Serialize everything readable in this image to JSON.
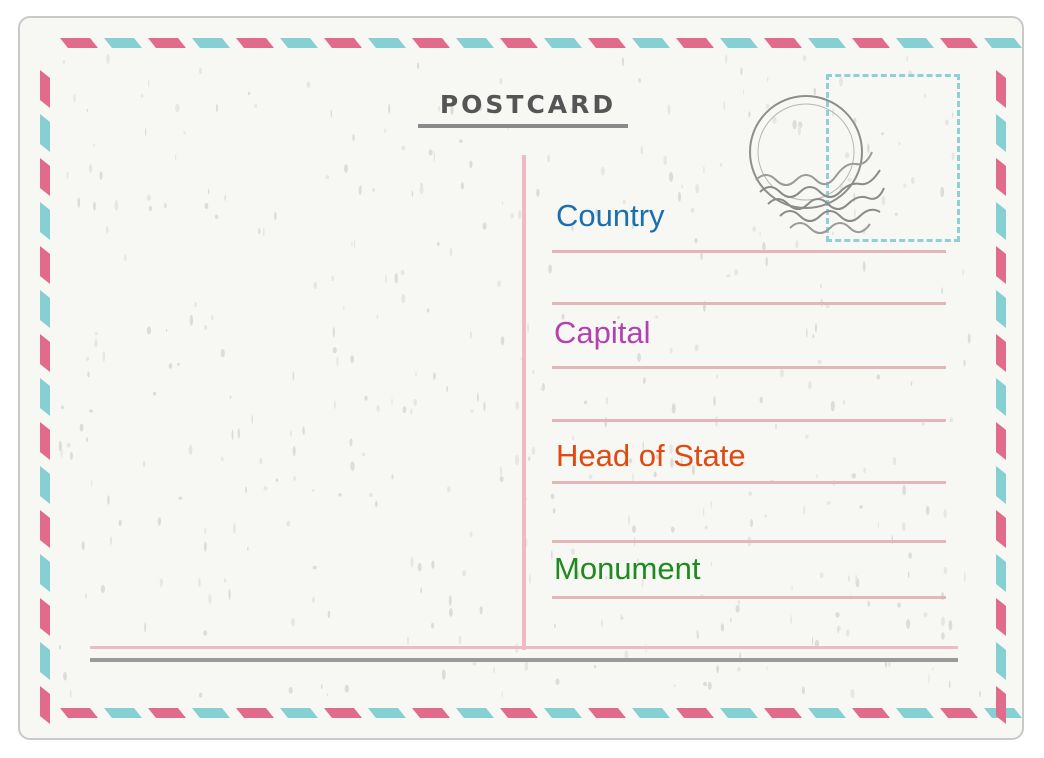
{
  "card": {
    "title": "POSTCARD"
  },
  "fields": [
    {
      "label": "Country",
      "color": "#1a6fb0"
    },
    {
      "label": "Capital",
      "color": "#b342b0"
    },
    {
      "label": "Head of State",
      "color": "#e04a10"
    },
    {
      "label": "Monument",
      "color": "#1f8a1f"
    }
  ],
  "colors": {
    "airmail_red": "#e06b8b",
    "airmail_blue": "#86cfd3",
    "card_bg": "#f7f7f3",
    "line_pink": "#e4b6b8"
  }
}
